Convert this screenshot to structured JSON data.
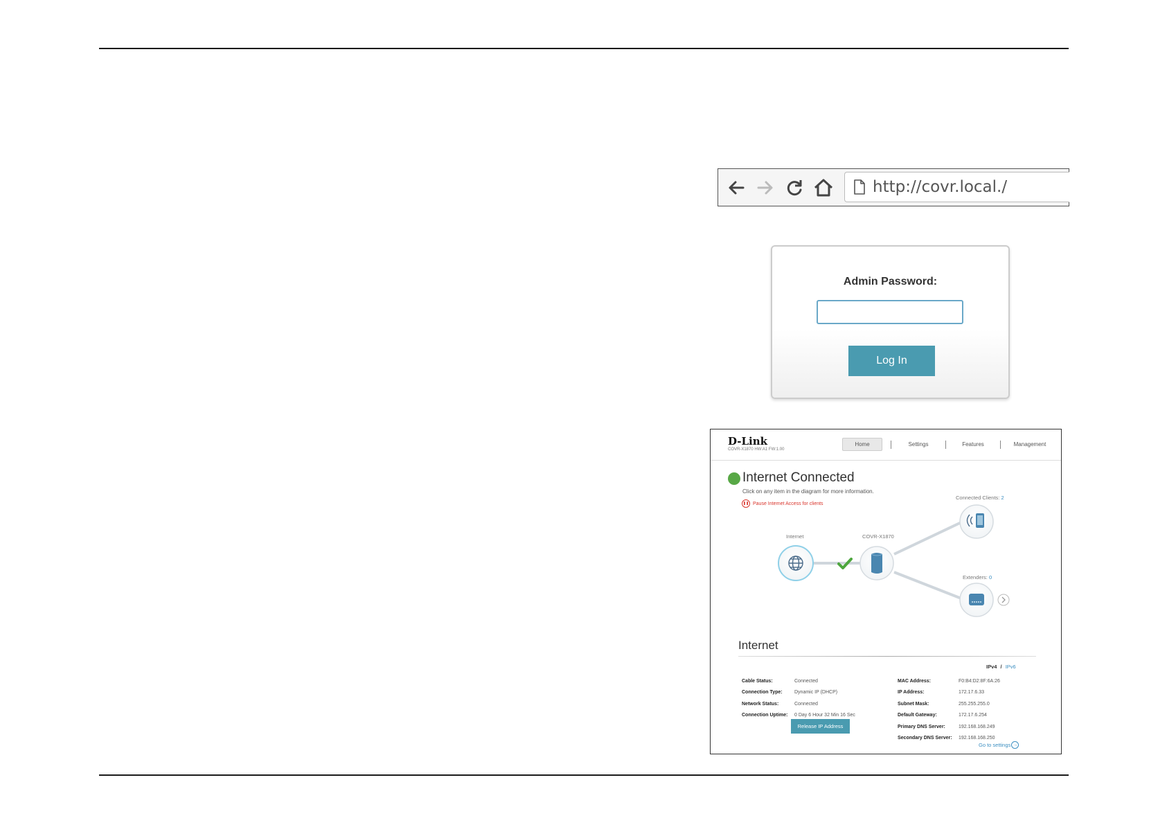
{
  "browser": {
    "url": "http://covr.local./",
    "icons": [
      "back-arrow-icon",
      "forward-arrow-icon",
      "reload-icon",
      "home-icon",
      "page-icon"
    ]
  },
  "login": {
    "label": "Admin Password:",
    "password_value": "",
    "button_label": "Log In"
  },
  "dashboard": {
    "brand": "D-Link",
    "model_line": "COVR-X1870 HW:A1 FW:1.00",
    "nav": [
      "Home",
      "Settings",
      "Features",
      "Management"
    ],
    "status_title": "Internet Connected",
    "hint": "Click on any item in the diagram for more information.",
    "pause_link": "Pause Internet Access for clients",
    "diagram": {
      "internet_label": "Internet",
      "router_label": "COVR-X1870",
      "clients_label": "Connected Clients:",
      "clients_count": "2",
      "extenders_label": "Extenders:",
      "extenders_count": "0"
    },
    "section_title": "Internet",
    "ip_toggle": {
      "v4": "IPv4",
      "sep": "/",
      "v6": "IPv6"
    },
    "left_info": [
      {
        "key": "Cable Status:",
        "value": "Connected"
      },
      {
        "key": "Connection Type:",
        "value": "Dynamic IP (DHCP)"
      },
      {
        "key": "Network Status:",
        "value": "Connected"
      },
      {
        "key": "Connection Uptime:",
        "value": "0 Day 6 Hour 32 Min 16 Sec"
      }
    ],
    "right_info": [
      {
        "key": "MAC Address:",
        "value": "F0:B4:D2:8F:6A:26"
      },
      {
        "key": "IP Address:",
        "value": "172.17.6.33"
      },
      {
        "key": "Subnet Mask:",
        "value": "255.255.255.0"
      },
      {
        "key": "Default Gateway:",
        "value": "172.17.6.254"
      },
      {
        "key": "Primary DNS Server:",
        "value": "192.168.168.249"
      },
      {
        "key": "Secondary DNS Server:",
        "value": "192.168.168.250"
      }
    ],
    "release_button": "Release IP Address",
    "goto_link": "Go to settings"
  },
  "colors": {
    "accent": "#4a9bb0",
    "link": "#3c8fc1",
    "status_green": "#58a846",
    "alert_red": "#d9342b"
  }
}
